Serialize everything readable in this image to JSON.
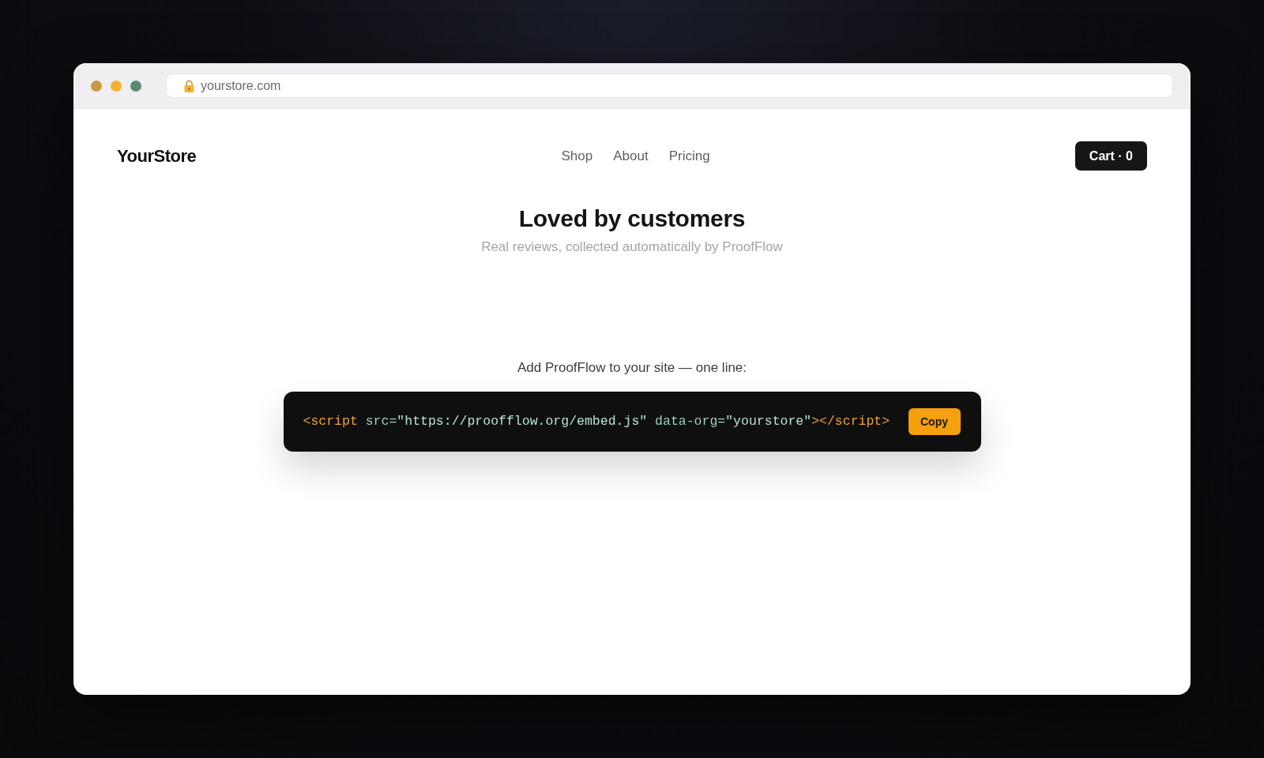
{
  "browser": {
    "url": "yourstore.com"
  },
  "nav": {
    "logo": "YourStore",
    "links": [
      "Shop",
      "About",
      "Pricing"
    ],
    "cart_button": "Cart · 0"
  },
  "hero": {
    "title": "Loved by customers",
    "subtitle": "Real reviews, collected automatically by ProofFlow"
  },
  "embed": {
    "label": "Add ProofFlow to your site — one line:",
    "code": [
      {
        "kind": "tag",
        "text": "<script"
      },
      {
        "kind": "attr",
        "text": " src="
      },
      {
        "kind": "string",
        "text": "\"https://proofflow.org/embed.js\""
      },
      {
        "kind": "attr",
        "text": " data-org="
      },
      {
        "kind": "string",
        "text": "\"yourstore\""
      },
      {
        "kind": "tag",
        "text": "></script>"
      }
    ],
    "copy_button": "Copy"
  }
}
